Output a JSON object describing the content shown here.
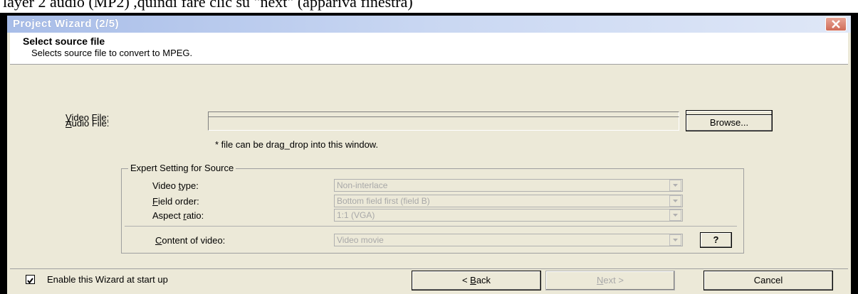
{
  "top_text": "layer 2 audio (MP2) ,quindi fare clic su \"next\" (appariva finestra)",
  "window": {
    "title": "Project Wizard (2/5)"
  },
  "header": {
    "title": "Select source file",
    "subtitle": "Selects source file to convert to MPEG."
  },
  "video_file": {
    "label_prefix": "",
    "label_underline": "V",
    "label_rest": "ideo File:",
    "value": "",
    "browse_label": "Browse..."
  },
  "audio_file": {
    "label_underline": "A",
    "label_rest": "udio File:",
    "value": "",
    "browse_label": "Browse..."
  },
  "drag_hint": "* file can be drag_drop into this window.",
  "expert": {
    "legend": "Expert Setting for Source",
    "video_type": {
      "label_pre": "Video ",
      "label_u": "t",
      "label_post": "ype:",
      "value": "Non-interlace"
    },
    "field_order": {
      "label_pre": "",
      "label_u": "F",
      "label_post": "ield order:",
      "value": "Bottom field first (field B)"
    },
    "aspect_ratio": {
      "label_pre": "Aspect ",
      "label_u": "r",
      "label_post": "atio:",
      "value": "1:1 (VGA)"
    },
    "content": {
      "label_pre": "",
      "label_u": "C",
      "label_post": "ontent of video:",
      "value": "Video movie"
    },
    "help_label": "?"
  },
  "footer": {
    "checkbox_label": "Enable this Wizard at start up",
    "checkbox_checked": true,
    "back_pre": "< ",
    "back_u": "B",
    "back_post": "ack",
    "next_u": "N",
    "next_post": "ext >",
    "cancel_label": "Cancel"
  },
  "colors": {
    "titlebar": "#a8bde8",
    "dialog_bg": "#ece9d8",
    "close_button": "#d06b57",
    "disabled_text": "#a8a8a8"
  }
}
